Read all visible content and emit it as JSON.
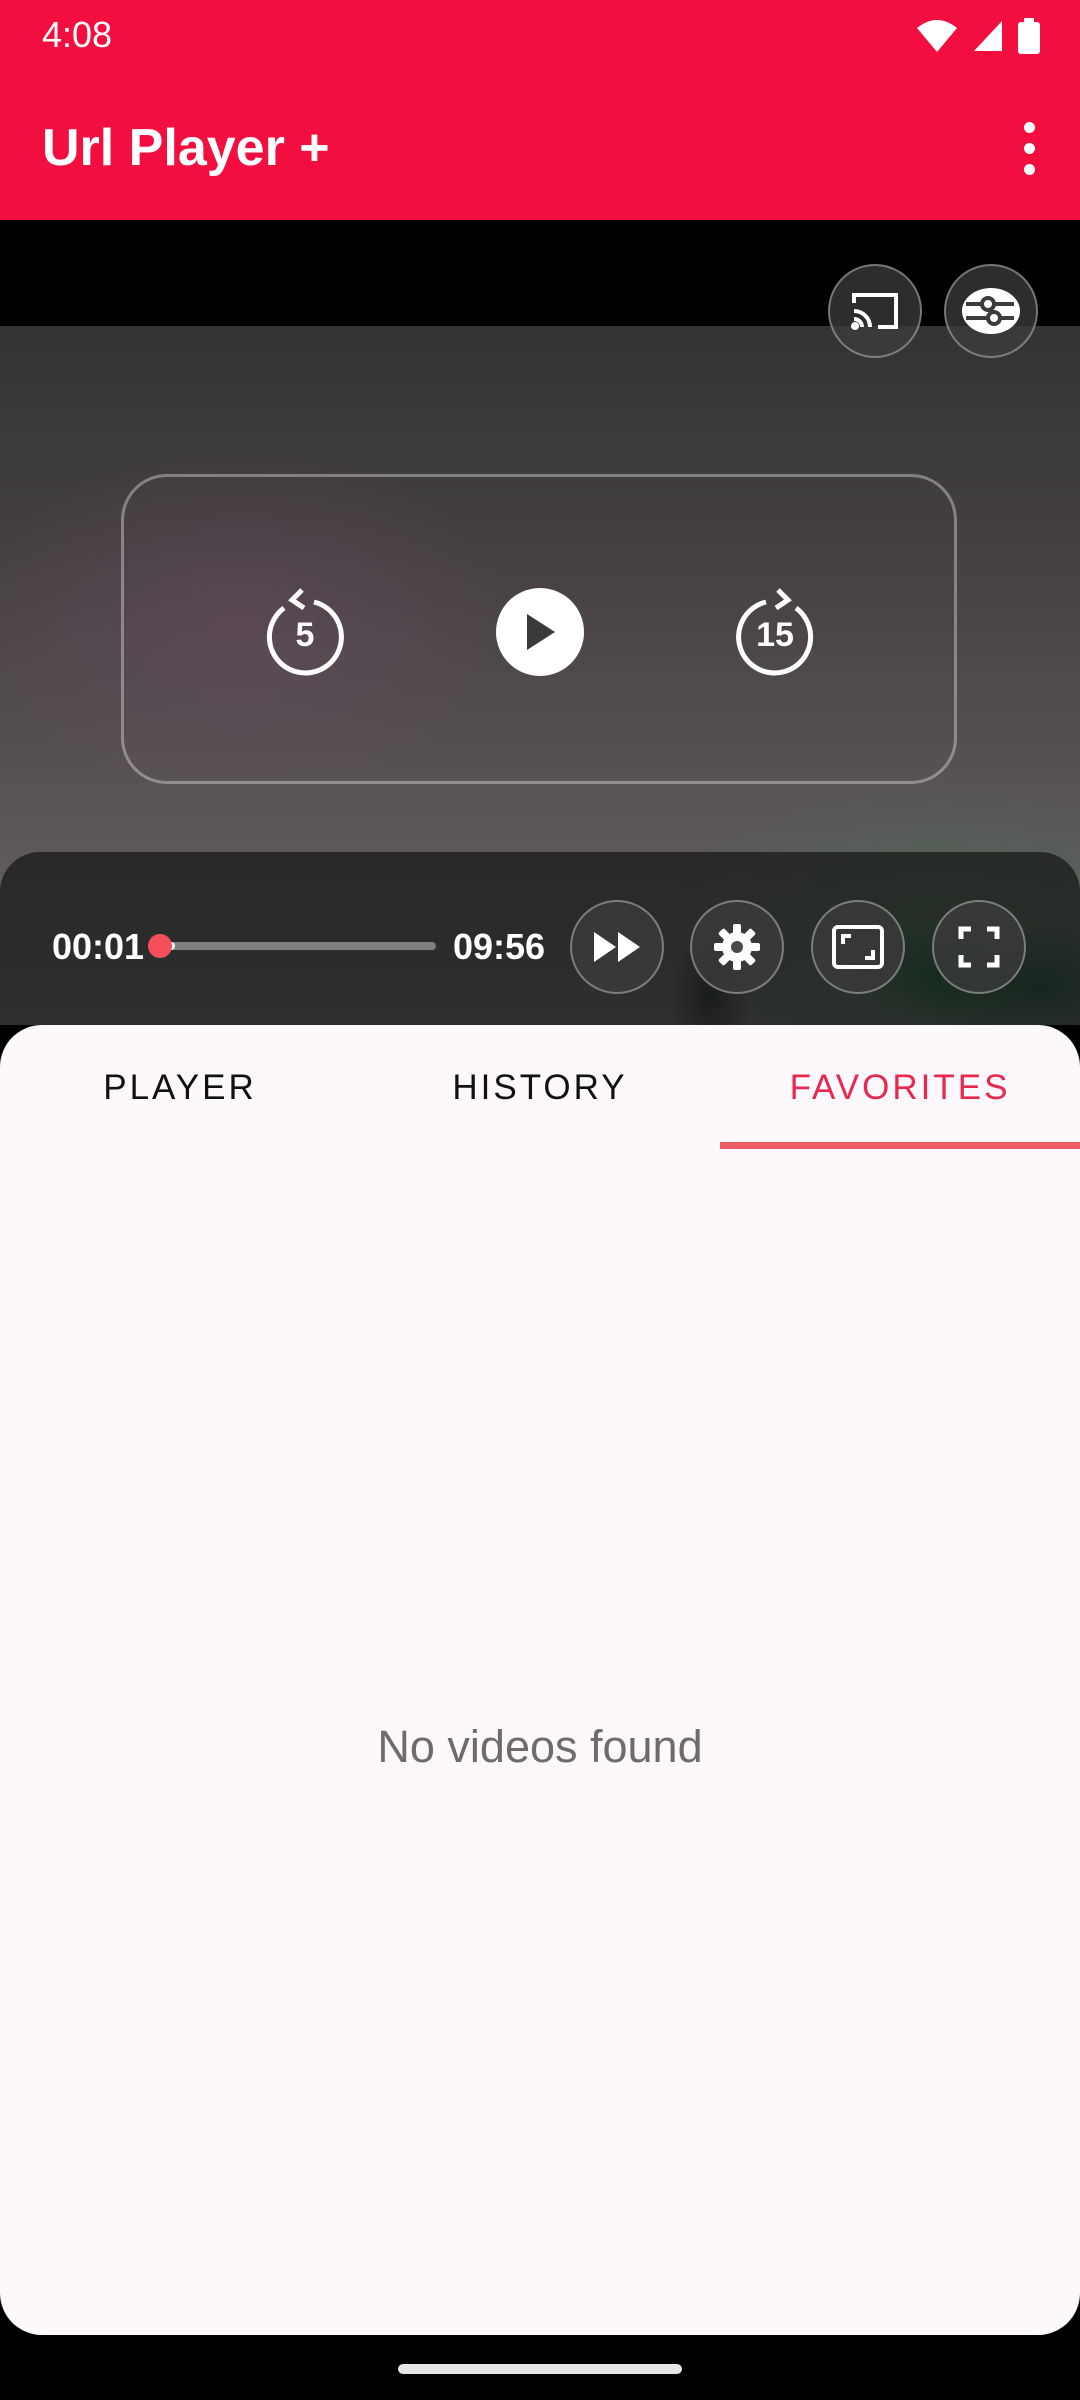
{
  "status_bar": {
    "time": "4:08"
  },
  "app_bar": {
    "title": "Url Player +"
  },
  "player": {
    "current_time": "00:01",
    "duration": "09:56",
    "progress": 0.0017,
    "buffered": 0.055,
    "rewind_seconds": "5",
    "forward_seconds": "15"
  },
  "tabs": [
    {
      "label": "PLAYER",
      "active": false
    },
    {
      "label": "HISTORY",
      "active": false
    },
    {
      "label": "FAVORITES",
      "active": true
    }
  ],
  "favorites": {
    "empty_message": "No videos found"
  },
  "colors": {
    "accent": "#f20f40",
    "active_tab": "#e8284f",
    "seek_thumb": "#f5505a"
  }
}
